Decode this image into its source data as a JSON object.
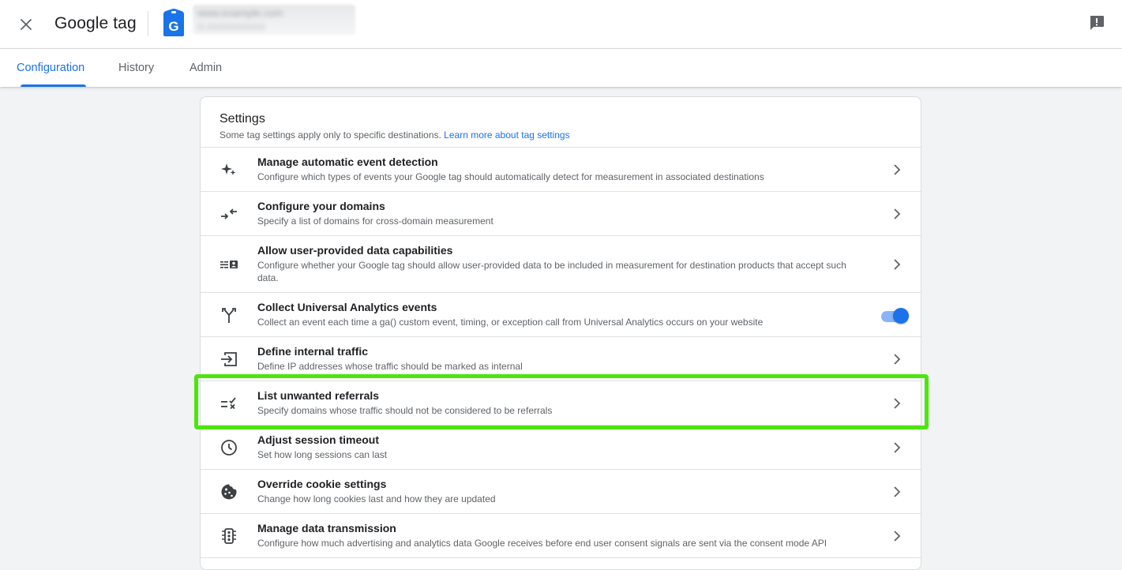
{
  "header": {
    "title": "Google tag",
    "logo_letter": "G",
    "account_name": "www.example.com",
    "account_id": "G-XXXXXXXXXX"
  },
  "tabs": [
    {
      "label": "Configuration",
      "active": true
    },
    {
      "label": "History",
      "active": false
    },
    {
      "label": "Admin",
      "active": false
    }
  ],
  "settings": {
    "title": "Settings",
    "subtitle": "Some tag settings apply only to specific destinations.",
    "link": "Learn more about tag settings",
    "items": [
      {
        "title": "Manage automatic event detection",
        "desc": "Configure which types of events your Google tag should automatically detect for measurement in associated destinations",
        "icon": "sparkle-icon",
        "control": "chevron"
      },
      {
        "title": "Configure your domains",
        "desc": "Specify a list of domains for cross-domain measurement",
        "icon": "arrows-inward-icon",
        "control": "chevron"
      },
      {
        "title": "Allow user-provided data capabilities",
        "desc": "Configure whether your Google tag should allow user-provided data to be included in measurement for destination products that accept such data.",
        "icon": "user-data-icon",
        "control": "chevron"
      },
      {
        "title": "Collect Universal Analytics events",
        "desc": "Collect an event each time a ga() custom event, timing, or exception call from Universal Analytics occurs on your website",
        "icon": "merge-icon",
        "control": "toggle",
        "toggle_on": true
      },
      {
        "title": "Define internal traffic",
        "desc": "Define IP addresses whose traffic should be marked as internal",
        "icon": "input-icon",
        "control": "chevron"
      },
      {
        "title": "List unwanted referrals",
        "desc": "Specify domains whose traffic should not be considered to be referrals",
        "icon": "rule-icon",
        "control": "chevron",
        "highlighted": true
      },
      {
        "title": "Adjust session timeout",
        "desc": "Set how long sessions can last",
        "icon": "clock-icon",
        "control": "chevron"
      },
      {
        "title": "Override cookie settings",
        "desc": "Change how long cookies last and how they are updated",
        "icon": "cookie-icon",
        "control": "chevron"
      },
      {
        "title": "Manage data transmission",
        "desc": "Configure how much advertising and analytics data Google receives before end user consent signals are sent via the consent mode API",
        "icon": "traffic-light-icon",
        "control": "chevron"
      }
    ]
  },
  "colors": {
    "accent": "#1a73e8",
    "highlight": "#4ee50e",
    "toggle_track": "#8ab4f8"
  }
}
